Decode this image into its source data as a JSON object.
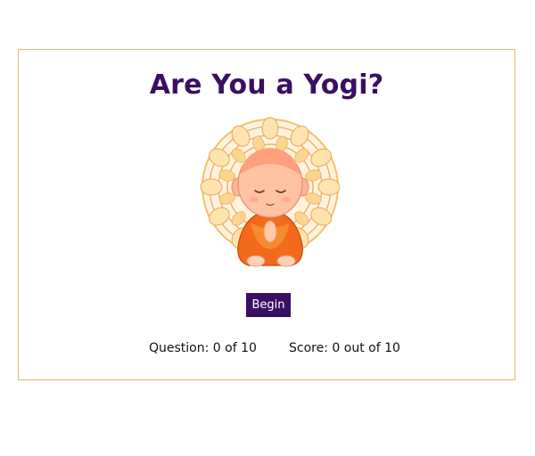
{
  "quiz": {
    "title": "Are You a Yogi?",
    "begin_label": "Begin",
    "question_label": "Question:",
    "question_current": "0",
    "question_of": "of",
    "question_total": "10",
    "score_label": "Score:",
    "score_current": "0",
    "score_out_of": "out of",
    "score_total": "10"
  },
  "illustration": {
    "icon": "meditating-monk-mandala-icon"
  },
  "colors": {
    "accent": "#3a0f63",
    "border": "#f0b46c",
    "robe": "#f26a1b",
    "mandala": "#f6c56d"
  }
}
